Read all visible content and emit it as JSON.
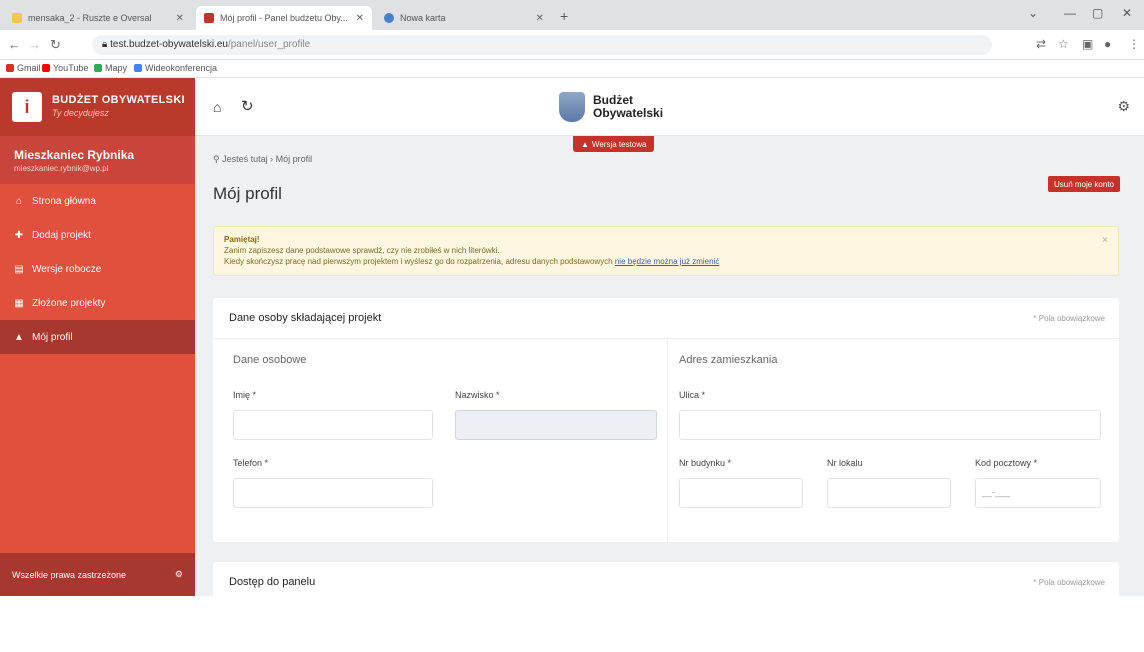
{
  "browser": {
    "tabs": [
      {
        "title": "mensaka_2 - Ruszte e Oversal",
        "color": "#f2c94c",
        "active": false
      },
      {
        "title": "Mój profil - Panel budżetu Oby...",
        "color": "#c8302a",
        "active": true
      },
      {
        "title": "Nowa karta",
        "color": "#4a7fd0",
        "active": false
      }
    ],
    "url_host": "test.budzet-obywatelski.eu",
    "url_path": "/panel/user_profile",
    "bookmarks": [
      {
        "label": "Gmail",
        "color": "#d93025"
      },
      {
        "label": "YouTube",
        "color": "#ff0000"
      },
      {
        "label": "Mapy",
        "color": "#34a853"
      },
      {
        "label": "Wideokonferencja",
        "color": "#4285f4"
      }
    ]
  },
  "sidebar": {
    "brand_title": "BUDŻET OBYWATELSKI",
    "brand_sub": "Ty decydujesz",
    "user_name": "Mieszkaniec Rybnika",
    "user_email": "mieszkaniec.rybnik@wp.pl",
    "items": [
      {
        "label": "Strona główna",
        "icon": "home-icon",
        "glyph": "⌂"
      },
      {
        "label": "Dodaj projekt",
        "icon": "plus-icon",
        "glyph": "✚"
      },
      {
        "label": "Wersje robocze",
        "icon": "document-icon",
        "glyph": "▤"
      },
      {
        "label": "Złożone projekty",
        "icon": "grid-icon",
        "glyph": "▦"
      },
      {
        "label": "Mój profil",
        "icon": "user-icon",
        "glyph": "▲"
      }
    ],
    "footer": "Wszelkie prawa zastrzeżone"
  },
  "topbar": {
    "logo_line1": "Budżet",
    "logo_line2": "Obywatelski",
    "version_badge": "Wersja testowa"
  },
  "page": {
    "breadcrumb_home": "Jesteś tutaj",
    "breadcrumb_current": "Mój profil",
    "title": "Mój profil",
    "delete_button": "Usuń moje konto"
  },
  "alert": {
    "title": "Pamiętaj!",
    "line1": "Zanim zapiszesz dane podstawowe sprawdź, czy nie zrobiłeś w nich literówki.",
    "line2": "Kiedy skończysz pracę nad pierwszym projektem i wyślesz go do rozpatrzenia, adresu danych podstawowych",
    "link": "nie będzie można już zmienić"
  },
  "form": {
    "card_title": "Dane osoby składającej projekt",
    "required_note": "* Pola obowiązkowe",
    "section_personal": "Dane osobowe",
    "section_address": "Adres zamieszkania",
    "first_name_label": "Imię *",
    "last_name_label": "Nazwisko *",
    "phone_label": "Telefon *",
    "street_label": "Ulica *",
    "building_label": "Nr budynku *",
    "apartment_label": "Nr lokalu",
    "postcode_label": "Kod pocztowy *",
    "postcode_placeholder": "__-___",
    "access_title": "Dostęp do panelu",
    "access_required_note": "* Pola obowiązkowe"
  }
}
